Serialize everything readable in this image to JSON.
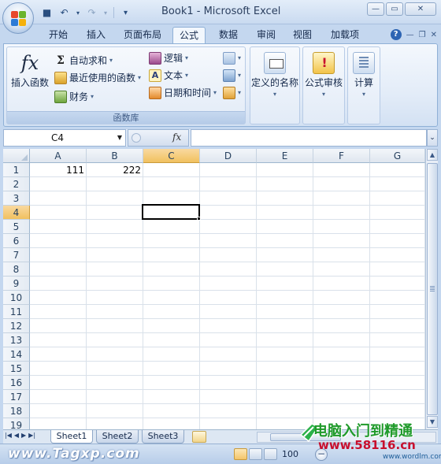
{
  "window": {
    "title": "Book1 - Microsoft Excel",
    "controls": {
      "minimize": "—",
      "maximize": "▭",
      "close": "✕"
    }
  },
  "quick_access": {
    "save_icon": "save-icon",
    "undo_icon": "undo-icon",
    "redo_icon": "redo-icon",
    "customize_icon": "customize-qat-icon"
  },
  "tabs": [
    "开始",
    "插入",
    "页面布局",
    "公式",
    "数据",
    "审阅",
    "视图",
    "加载项"
  ],
  "active_tab": "公式",
  "ribbon": {
    "function_library": {
      "label": "函数库",
      "insert_function": "插入函数",
      "autosum": "自动求和",
      "recent": "最近使用的函数",
      "financial": "财务",
      "logical": "逻辑",
      "text": "文本",
      "datetime": "日期和时间"
    },
    "defined_names": "定义的名称",
    "formula_auditing": "公式审核",
    "calculation": "计算"
  },
  "formula_bar": {
    "name_box": "C4",
    "fx": "fx",
    "value": ""
  },
  "grid": {
    "columns": [
      "A",
      "B",
      "C",
      "D",
      "E",
      "F",
      "G"
    ],
    "rows": [
      "1",
      "2",
      "3",
      "4",
      "5",
      "6",
      "7",
      "8",
      "9",
      "10",
      "11",
      "12",
      "13",
      "14",
      "15",
      "16",
      "17",
      "18",
      "19"
    ],
    "cells": {
      "A1": "111",
      "B1": "222"
    },
    "active_cell": "C4",
    "selected_column": "C",
    "selected_row": "4"
  },
  "sheets": [
    "Sheet1",
    "Sheet2",
    "Sheet3"
  ],
  "active_sheet": "Sheet1",
  "status": {
    "zoom": "100"
  },
  "watermarks": {
    "left": "www.Tagxp.com",
    "right_title": "电脑入门到精通",
    "right_url": "www.58116.cn",
    "right_small": "www.wordlm.com"
  },
  "colors": {
    "accent": "#c4d7ef",
    "selected_header": "#f1c15f",
    "watermark_green": "#1f9a2a",
    "watermark_red": "#c8102e"
  }
}
